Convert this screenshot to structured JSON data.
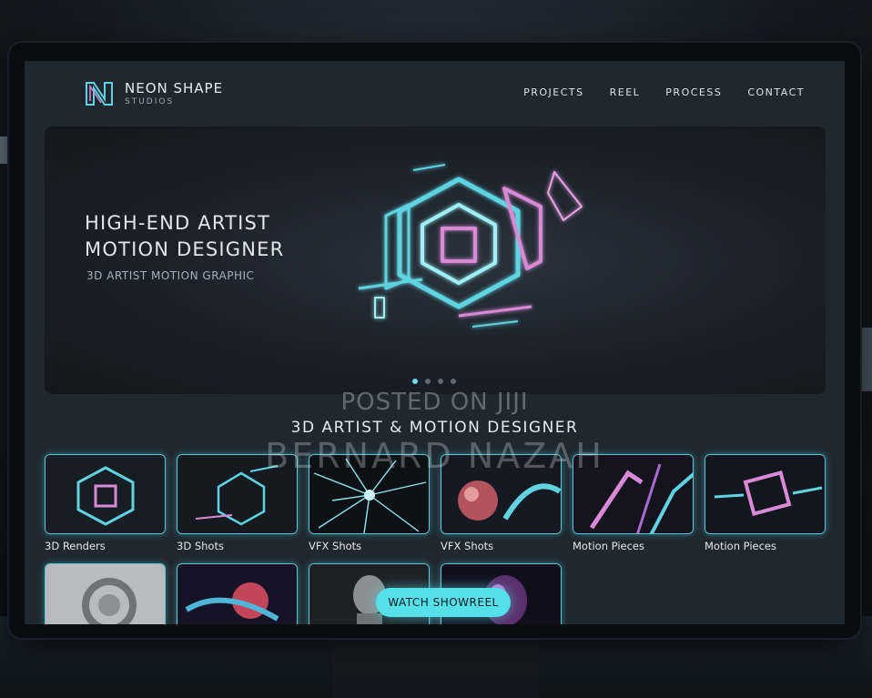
{
  "brand": {
    "name": "NEON SHAPE",
    "sub": "STUDIOS"
  },
  "nav": [
    {
      "label": "PROJECTS"
    },
    {
      "label": "REEL"
    },
    {
      "label": "PROCESS"
    },
    {
      "label": "CONTACT"
    }
  ],
  "hero": {
    "title": "HIGH-END ARTIST\nMOTION DESIGNER",
    "subtitle": "3D ARTIST MOTION GRAPHIC",
    "slides_total": 4,
    "slide_active": 1
  },
  "watermark": {
    "line1": "POSTED ON JIJI",
    "line2": "BERNARD NAZAH"
  },
  "section": {
    "title": "3D ARTIST & MOTION DESIGNER"
  },
  "gallery": [
    {
      "label": "3D Renders"
    },
    {
      "label": "3D Shots"
    },
    {
      "label": "VFX Shots"
    },
    {
      "label": "VFX Shots"
    },
    {
      "label": "Motion Pieces"
    },
    {
      "label": "Motion Pieces"
    }
  ],
  "cta": {
    "label": "WATCH SHOWREEL"
  },
  "colors": {
    "accent": "#55e0ea",
    "pink": "#d98ad6",
    "screen_bg": "#1f272f"
  }
}
